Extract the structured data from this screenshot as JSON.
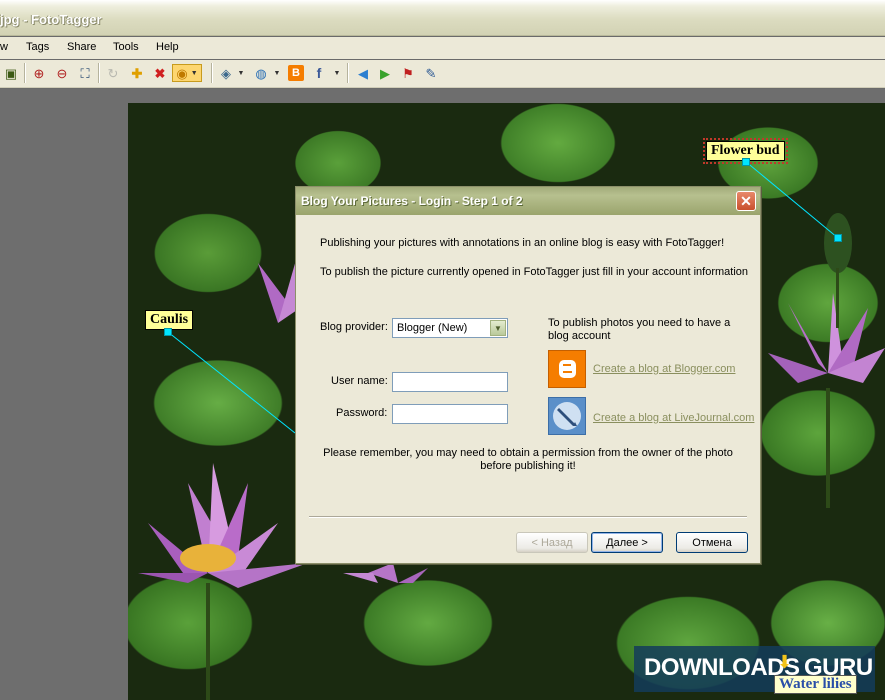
{
  "window": {
    "title": "jpg - FotoTagger"
  },
  "menu": [
    "w",
    "Tags",
    "Share",
    "Tools",
    "Help"
  ],
  "toolbar_icons": [
    "organizer-icon",
    "zoom-in-icon",
    "zoom-out-icon",
    "fit-icon",
    "rotate-icon",
    "add-tag-icon",
    "delete-tag-icon",
    "bulb-icon",
    "tag-style-icon",
    "globe-icon",
    "blogger-icon",
    "facebook-icon",
    "back-icon",
    "forward-icon",
    "flag-icon",
    "note-icon"
  ],
  "tags": {
    "flower_bud": "Flower bud",
    "caulis": "Caulis"
  },
  "dialog": {
    "title": "Blog Your Pictures - Login - Step 1 of 2",
    "intro1": "Publishing your pictures with annotations in an online blog is easy with FotoTagger!",
    "intro2": "To publish the picture currently opened in FotoTagger just fill in your account information",
    "provider_label": "Blog provider:",
    "provider_value": "Blogger (New)",
    "username_label": "User name:",
    "username_value": "",
    "password_label": "Password:",
    "password_value": "",
    "publish_hint": "To publish photos you need to have a blog account",
    "link_blogger": "Create a blog at Blogger.com",
    "link_livejournal": "Create a blog at LiveJournal.com",
    "reminder1": "Please remember, you may need to obtain a permission from the owner of the photo",
    "reminder2": "before publishing it!",
    "btn_back": "< Назад",
    "btn_next": "Далее >",
    "btn_cancel": "Отмена"
  },
  "watermark": {
    "brand_left": "DOWNLOADS",
    "brand_right": "GURU"
  },
  "photo_caption": "Water lilies",
  "colors": {
    "blogger": "#f57d00",
    "livejournal": "#5a8fc9",
    "tag_bg": "#ffff99",
    "handle": "#00e5ff"
  }
}
